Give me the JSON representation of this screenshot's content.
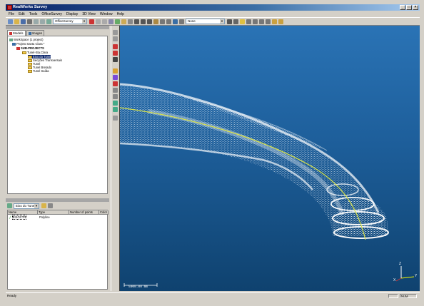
{
  "window": {
    "title": "RealWorks Survey",
    "minimize": "_",
    "maximize": "□",
    "close": "×"
  },
  "menu": [
    "File",
    "Edit",
    "Tools",
    "OfficeSurvey",
    "Display",
    "3D View",
    "Window",
    "Help"
  ],
  "toolbar": {
    "mode_combo": "OfficeSurvey",
    "view_combo": "None"
  },
  "workspace": {
    "tabs": [
      {
        "label": "Models"
      },
      {
        "label": "Images"
      }
    ],
    "tree": {
      "workspace": "WorkSpace (1 project)",
      "project": "Projeto Santa Clara *",
      "subprojects": "SUB-PROJECTS",
      "group": "Tunel-Sta.Clara",
      "items": [
        "Eixo do Tunel",
        "Secções Transversais",
        "Tunel",
        "Tunel Bretado",
        "Tunel Saída"
      ],
      "selected_index": 0
    }
  },
  "objects": {
    "selector": "Eixo do Tunel",
    "columns": [
      "Name",
      "Type",
      "Number of points",
      "Color"
    ],
    "rows": [
      {
        "name": "EIXOCTR",
        "type": "Polyline",
        "points": "",
        "color": ""
      }
    ]
  },
  "viewport": {
    "scale_label": "5000.00 mm",
    "axes": {
      "x": "X",
      "y": "Y",
      "z": "Z"
    },
    "colors": {
      "background_top": "#2a73b5",
      "background_bottom": "#0f426f",
      "axis_line": "#d8e24a",
      "pointcloud": "#ffffff"
    }
  },
  "status": {
    "left": "Ready",
    "right": "NUM"
  },
  "icons": [
    "app-icon",
    "new-icon",
    "open-icon",
    "save-icon",
    "print-icon",
    "undo-icon",
    "redo-icon",
    "cursor-icon",
    "zoom-icon",
    "rotate-icon",
    "pan-icon",
    "folder-icon",
    "polyline-icon",
    "axis-icon"
  ]
}
